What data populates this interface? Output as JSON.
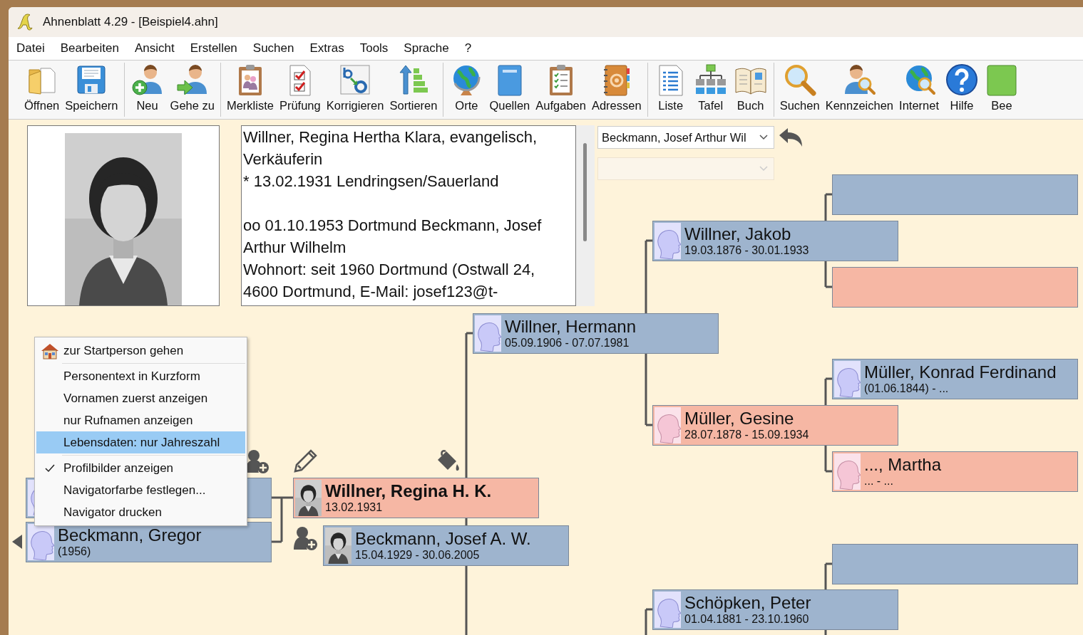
{
  "window": {
    "title": "Ahnenblatt 4.29 - [Beispiel4.ahn]"
  },
  "menu": [
    "Datei",
    "Bearbeiten",
    "Ansicht",
    "Erstellen",
    "Suchen",
    "Extras",
    "Tools",
    "Sprache",
    "?"
  ],
  "toolbar": {
    "groups": [
      [
        {
          "label": "Öffnen"
        },
        {
          "label": "Speichern"
        }
      ],
      [
        {
          "label": "Neu"
        },
        {
          "label": "Gehe zu"
        }
      ],
      [
        {
          "label": "Merkliste"
        },
        {
          "label": "Prüfung"
        },
        {
          "label": "Korrigieren"
        },
        {
          "label": "Sortieren"
        }
      ],
      [
        {
          "label": "Orte"
        },
        {
          "label": "Quellen"
        },
        {
          "label": "Aufgaben"
        },
        {
          "label": "Adressen"
        }
      ],
      [
        {
          "label": "Liste"
        },
        {
          "label": "Tafel"
        },
        {
          "label": "Buch"
        }
      ],
      [
        {
          "label": "Suchen"
        },
        {
          "label": "Kennzeichen"
        },
        {
          "label": "Internet"
        },
        {
          "label": "Hilfe"
        },
        {
          "label": "Bee"
        }
      ]
    ]
  },
  "person_text": {
    "paragraphs": [
      [
        "Willner, Regina Hertha Klara, evangelisch,",
        "Verkäuferin",
        "* 13.02.1931 Lendringsen/Sauerland"
      ],
      [
        "oo 01.10.1953 Dortmund Beckmann, Josef",
        "Arthur Wilhelm",
        "Wohnort: seit 1960 Dortmund (Ostwall 24,",
        "4600 Dortmund, E-Mail: josef123@t-"
      ]
    ]
  },
  "dropdowns": [
    {
      "value": "Beckmann, Josef Arthur Wil",
      "disabled": false
    },
    {
      "disabled": true
    }
  ],
  "nodes": [
    {
      "kind": "empty",
      "color": "#9eb4ce"
    },
    {
      "kind": "male",
      "name": "Willner, Jakob",
      "dates": "19.03.1876 - 30.01.1933",
      "color": "#9eb4ce",
      "selected": false
    },
    {
      "kind": "empty",
      "color": "#f6b7a4"
    },
    {
      "kind": "male",
      "name": "Willner, Hermann",
      "dates": "05.09.1906 - 07.07.1981",
      "color": "#9eb4ce",
      "selected": false
    },
    {
      "kind": "male",
      "name": "Müller, Konrad Ferdinand",
      "dates": "(01.06.1844) - ...",
      "color": "#9eb4ce",
      "selected": false
    },
    {
      "kind": "female",
      "name": "Müller, Gesine",
      "dates": "28.07.1878 - 15.09.1934",
      "color": "#f6b7a4",
      "selected": false
    },
    {
      "kind": "female",
      "name": "..., Martha",
      "dates": "... - ...",
      "color": "#f6b7a4",
      "selected": false
    },
    {
      "kind": "male",
      "color": "#9eb4ce"
    },
    {
      "name": "Willner, Regina H. K.",
      "dates": "13.02.1931",
      "color": "#f6b7a4",
      "selected": true
    },
    {
      "kind": "male",
      "name": "Beckmann, Gregor",
      "dates": "(1956)",
      "color": "#9eb4ce",
      "selected": false
    },
    {
      "name": "Beckmann, Josef A. W.",
      "dates": "15.04.1929 - 30.06.2005",
      "color": "#9eb4ce",
      "selected": false
    },
    {
      "kind": "empty",
      "color": "#9eb4ce"
    },
    {
      "kind": "male",
      "name": "Schöpken, Peter",
      "dates": "01.04.1881 - 23.10.1960",
      "color": "#9eb4ce",
      "selected": false
    }
  ],
  "context_menu": {
    "groups": [
      [
        {
          "label": "zur Startperson gehen",
          "checked": false,
          "selected": false
        }
      ],
      [
        {
          "label": "Personentext in Kurzform",
          "checked": false,
          "selected": false
        },
        {
          "label": "Vornamen zuerst anzeigen",
          "checked": false,
          "selected": false
        },
        {
          "label": "nur Rufnamen anzeigen",
          "checked": false,
          "selected": false
        },
        {
          "label": "Lebensdaten: nur Jahreszahl",
          "checked": false,
          "selected": true
        }
      ],
      [
        {
          "label": "Profilbilder anzeigen",
          "checked": true,
          "selected": false
        },
        {
          "label": "Navigatorfarbe festlegen...",
          "checked": false,
          "selected": false
        },
        {
          "label": "Navigator drucken",
          "checked": false,
          "selected": false
        }
      ]
    ]
  }
}
